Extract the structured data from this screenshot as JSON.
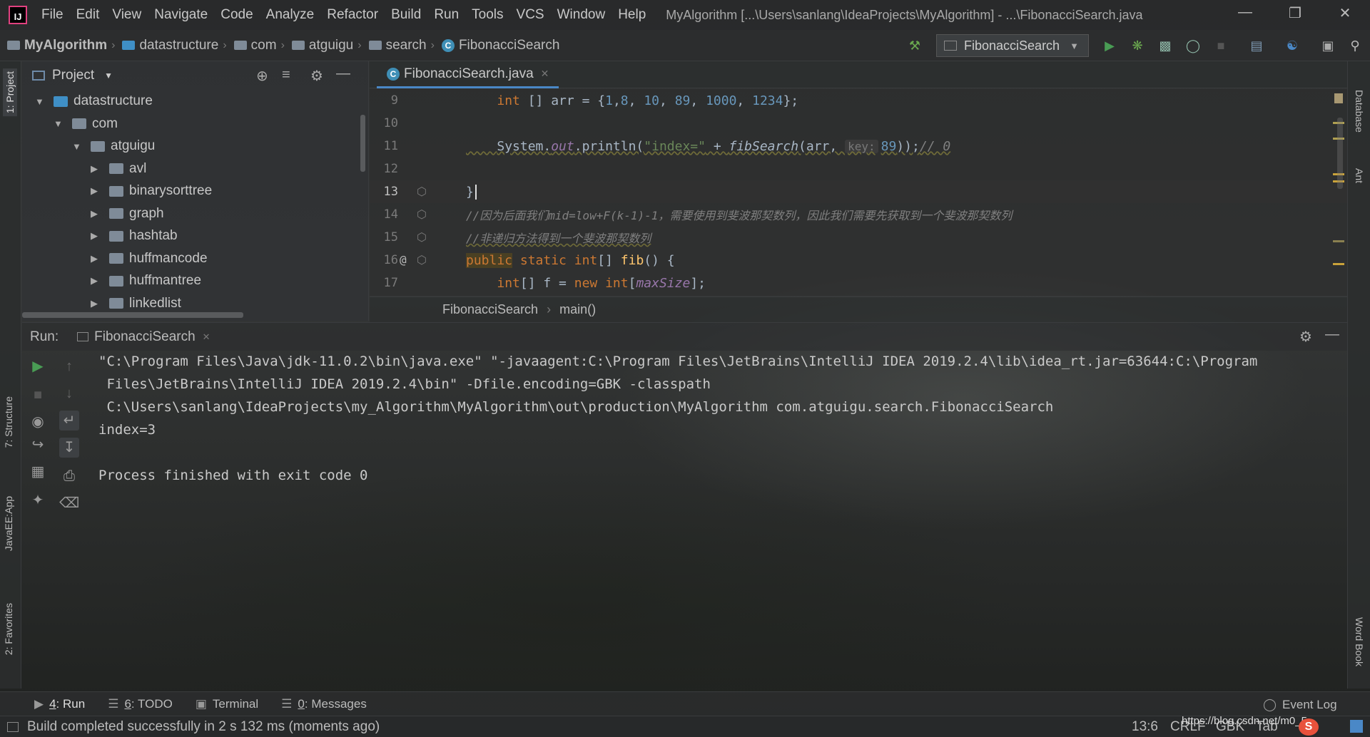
{
  "window": {
    "title": "MyAlgorithm [...\\Users\\sanlang\\IdeaProjects\\MyAlgorithm] - ...\\FibonacciSearch.java",
    "logo_text": "IJ"
  },
  "menu": [
    "File",
    "Edit",
    "View",
    "Navigate",
    "Code",
    "Analyze",
    "Refactor",
    "Build",
    "Run",
    "Tools",
    "VCS",
    "Window",
    "Help"
  ],
  "breadcrumbs": [
    "MyAlgorithm",
    "datastructure",
    "com",
    "atguigu",
    "search",
    "FibonacciSearch"
  ],
  "run_config": "FibonacciSearch",
  "left_tabs": [
    "1: Project",
    "7: Structure",
    "JavaEE:App",
    "2: Favorites"
  ],
  "right_tabs": [
    "Database",
    "Ant",
    "Word Book"
  ],
  "project": {
    "title": "Project",
    "tree": [
      {
        "label": "datastructure",
        "expanded": true
      },
      {
        "label": "com",
        "expanded": true
      },
      {
        "label": "atguigu",
        "expanded": true
      },
      {
        "label": "avl",
        "expanded": false
      },
      {
        "label": "binarysorttree",
        "expanded": false
      },
      {
        "label": "graph",
        "expanded": false
      },
      {
        "label": "hashtab",
        "expanded": false
      },
      {
        "label": "huffmancode",
        "expanded": false
      },
      {
        "label": "huffmantree",
        "expanded": false
      },
      {
        "label": "linkedlist",
        "expanded": false
      }
    ]
  },
  "editor": {
    "tab": "FibonacciSearch.java",
    "lines": [
      {
        "num": "9"
      },
      {
        "num": "10"
      },
      {
        "num": "11"
      },
      {
        "num": "12"
      },
      {
        "num": "13"
      },
      {
        "num": "14"
      },
      {
        "num": "15"
      },
      {
        "num": "16"
      },
      {
        "num": "17"
      }
    ],
    "code": {
      "l9_a": "int",
      "l9_b": " [] arr = {",
      "l9_nums": [
        "1",
        "8",
        "10",
        "89",
        "1000",
        "1234"
      ],
      "l9_end": "};",
      "l11_sys": "System.",
      "l11_out": "out",
      "l11_println": ".println(",
      "l11_str": "\"index=\"",
      "l11_plus": " + ",
      "l11_fn": "fibSearch",
      "l11_args": "(arr, ",
      "l11_hint": "key:",
      "l11_key": "89",
      "l11_close": "));",
      "l11_comment": "// 0",
      "l13": "}",
      "l14": "//因为后面我们mid=low+F(k-1)-1，需要使用到斐波那契数列，因此我们需要先获取到一个斐波那契数列",
      "l15": "//非递归方法得到一个斐波那契数列",
      "l16_public": "public",
      "l16_static": "static",
      "l16_type": "int",
      "l16_brackets": "[] ",
      "l16_fn": "fib",
      "l16_rest": "() {",
      "l17_type": "int",
      "l17_mid": "[] f = ",
      "l17_new": "new",
      "l17_int": "int",
      "l17_open": "[",
      "l17_field": "maxSize",
      "l17_end": "];",
      "l16_gutter": "@"
    },
    "crumbs": [
      "FibonacciSearch",
      "main()"
    ]
  },
  "run": {
    "label": "Run:",
    "tab": "FibonacciSearch",
    "output": [
      "\"C:\\Program Files\\Java\\jdk-11.0.2\\bin\\java.exe\" \"-javaagent:C:\\Program Files\\JetBrains\\IntelliJ IDEA 2019.2.4\\lib\\idea_rt.jar=63644:C:\\Program",
      " Files\\JetBrains\\IntelliJ IDEA 2019.2.4\\bin\" -Dfile.encoding=GBK -classpath",
      " C:\\Users\\sanlang\\IdeaProjects\\my_Algorithm\\MyAlgorithm\\out\\production\\MyAlgorithm com.atguigu.search.FibonacciSearch",
      "index=3",
      "",
      "Process finished with exit code 0"
    ]
  },
  "bottom_tabs": [
    {
      "num": "4",
      "label": ": Run"
    },
    {
      "num": "6",
      "label": ": TODO"
    },
    {
      "num": "",
      "label": "Terminal"
    },
    {
      "num": "0",
      "label": ": Messages"
    }
  ],
  "event_log": "Event Log",
  "status": {
    "message": "Build completed successfully in 2 s 132 ms (moments ago)",
    "position": "13:6",
    "line_sep": "CRLF",
    "encoding": "GBK",
    "indent": "Tab",
    "watermark": "https://blog.csdn.net/m0_5..."
  },
  "colors": {
    "accent": "#4a88c7",
    "run_green": "#499c54",
    "keyword": "#cc7832",
    "number": "#6897bb",
    "string": "#6a8759"
  }
}
